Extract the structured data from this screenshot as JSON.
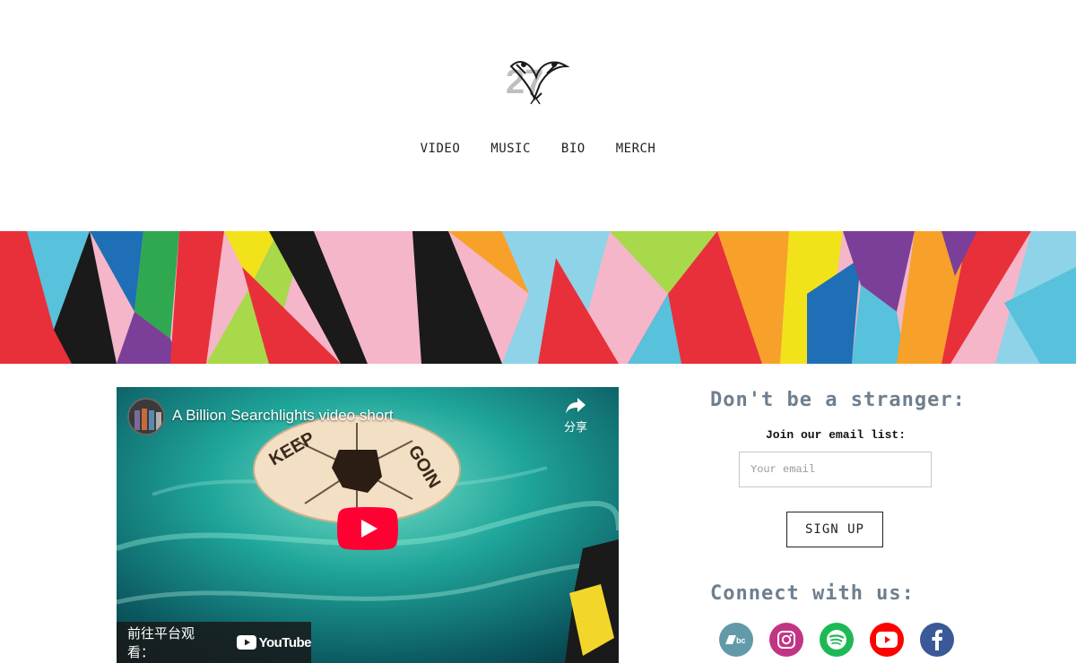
{
  "nav": {
    "items": [
      "VIDEO",
      "MUSIC",
      "BIO",
      "MERCH"
    ]
  },
  "video": {
    "title": "A Billion Searchlights video short",
    "share_label": "分享",
    "watch_on_label": "前往平台观看：",
    "platform_label": "YouTube"
  },
  "signup": {
    "heading": "Don't be a stranger:",
    "join_label": "Join our email list:",
    "email_placeholder": "Your email",
    "button_label": "SIGN UP"
  },
  "connect": {
    "heading": "Connect with us:",
    "icons": [
      "bandcamp-icon",
      "instagram-icon",
      "spotify-icon",
      "youtube-icon",
      "facebook-icon"
    ]
  },
  "colors": {
    "heading": "#6e7f8f",
    "bandcamp": "#629aa9",
    "instagram": "#c13584",
    "spotify": "#1db954",
    "youtube": "#ff0000",
    "facebook": "#3b5998"
  }
}
